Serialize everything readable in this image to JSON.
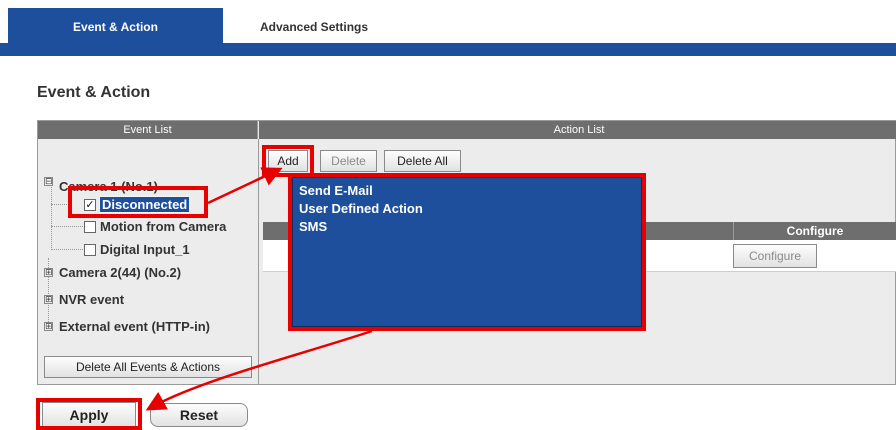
{
  "tabs": [
    {
      "label": "Event & Action",
      "active": true
    },
    {
      "label": "Advanced Settings",
      "active": false
    }
  ],
  "page_title": "Event & Action",
  "event_list": {
    "header": "Event List",
    "items": [
      {
        "label": "Camera 1 (No.1)",
        "expander": "⊟"
      },
      {
        "label": "Disconnected",
        "checked": true,
        "selected": true
      },
      {
        "label": "Motion from Camera",
        "checked": false
      },
      {
        "label": "Digital Input_1",
        "checked": false
      },
      {
        "label": "Camera 2(44) (No.2)",
        "expander": "⊞"
      },
      {
        "label": "NVR event",
        "expander": "⊞"
      },
      {
        "label": "External event (HTTP-in)",
        "expander": "⊞"
      }
    ],
    "delete_all_label": "Delete All Events & Actions"
  },
  "action_list": {
    "header": "Action List",
    "add_label": "Add",
    "delete_label": "Delete",
    "delete_all_label": "Delete All",
    "configure_column": "Configure",
    "configure_button": "Configure",
    "add_menu": [
      "Send E-Mail",
      "User Defined Action",
      "SMS"
    ]
  },
  "footer": {
    "apply_label": "Apply",
    "reset_label": "Reset"
  },
  "colors": {
    "accent": "#1e4f9c",
    "header_gray": "#6e6e6e",
    "highlight": "#e60000"
  }
}
